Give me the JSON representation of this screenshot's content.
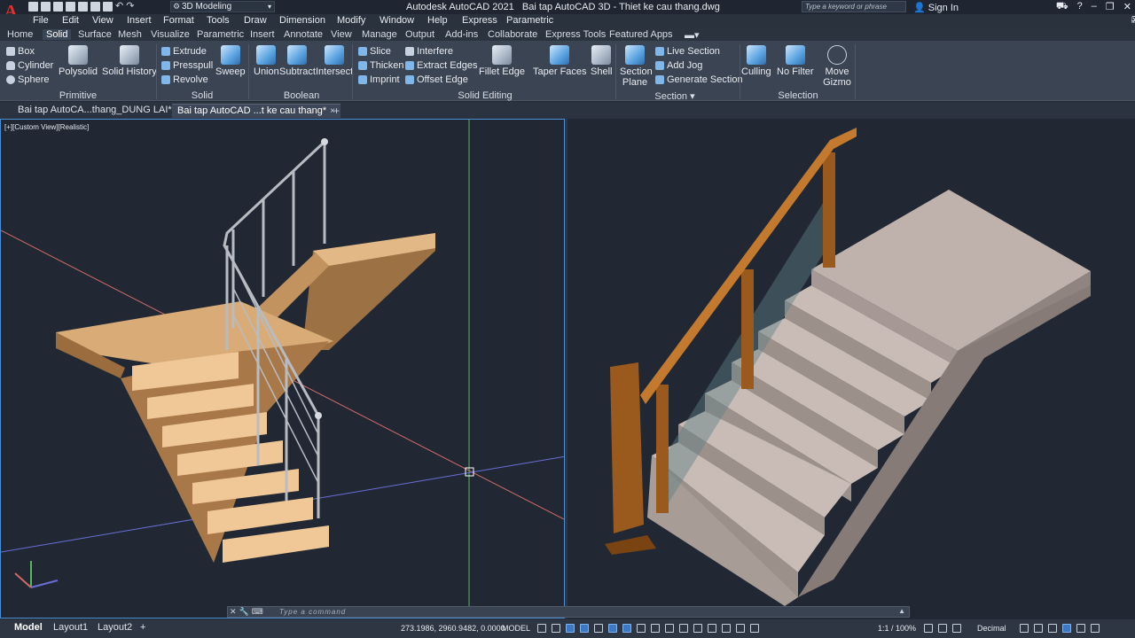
{
  "app": {
    "title": "Autodesk AutoCAD 2021",
    "doc_title": "Bai tap AutoCAD 3D - Thiet ke cau thang.dwg",
    "workspace": "3D Modeling",
    "search_placeholder": "Type a keyword or phrase",
    "sign_in": "Sign In",
    "logo": "A"
  },
  "menu": [
    "File",
    "Edit",
    "View",
    "Insert",
    "Format",
    "Tools",
    "Draw",
    "Dimension",
    "Modify",
    "Window",
    "Help",
    "Express",
    "Parametric"
  ],
  "ribbon_tabs": [
    "Home",
    "Solid",
    "Surface",
    "Mesh",
    "Visualize",
    "Parametric",
    "Insert",
    "Annotate",
    "View",
    "Manage",
    "Output",
    "Add-ins",
    "Collaborate",
    "Express Tools",
    "Featured Apps"
  ],
  "ribbon_active_tab": "Solid",
  "ribbon": {
    "primitive": {
      "title": "Primitive",
      "box": "Box",
      "cylinder": "Cylinder",
      "sphere": "Sphere",
      "polysolid": "Polysolid",
      "solid_history": "Solid History"
    },
    "solid": {
      "title": "Solid",
      "extrude": "Extrude",
      "presspull": "Presspull",
      "revolve": "Revolve",
      "sweep": "Sweep"
    },
    "boolean": {
      "title": "Boolean",
      "union": "Union",
      "subtract": "Subtract",
      "intersect": "Intersect"
    },
    "solid_editing": {
      "title": "Solid Editing",
      "slice": "Slice",
      "thicken": "Thicken",
      "imprint": "Imprint",
      "interfere": "Interfere",
      "extract_edges": "Extract Edges",
      "offset_edge": "Offset Edge",
      "fillet_edge": "Fillet Edge",
      "taper_faces": "Taper Faces",
      "shell": "Shell"
    },
    "section": {
      "title": "Section",
      "section_plane": "Section Plane",
      "live_section": "Live Section",
      "add_jog": "Add Jog",
      "generate_section": "Generate Section"
    },
    "selection": {
      "title": "Selection",
      "culling": "Culling",
      "no_filter": "No Filter",
      "move_gizmo": "Move Gizmo"
    }
  },
  "doc_tabs": [
    {
      "label": "Bai tap AutoCA...thang_DUNG LAI*"
    },
    {
      "label": "Bai tap AutoCAD ...t ke cau thang*",
      "close": "×"
    }
  ],
  "viewport": {
    "label": "[+][Custom View][Realistic]"
  },
  "command": {
    "placeholder": "Type a command"
  },
  "status": {
    "layout_tabs": [
      "Model",
      "Layout1",
      "Layout2"
    ],
    "coords": "273.1986, 2960.9482, 0.0000",
    "space": "MODEL",
    "scale": "1:1 / 100%",
    "units": "Decimal"
  },
  "colors": {
    "accent": "#4a8fd6",
    "titlebar": "#1f2631",
    "ribbon": "#3b4453",
    "viewport_bg": "#212834",
    "logo": "#e0322b"
  }
}
